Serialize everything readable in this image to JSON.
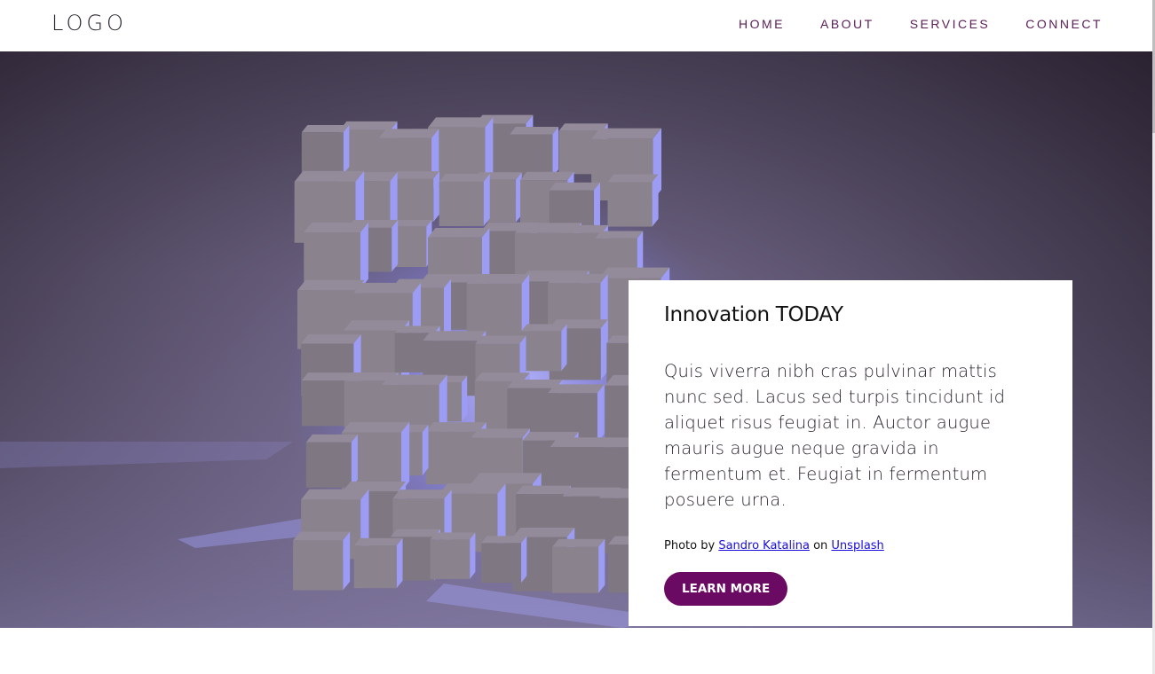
{
  "nav": {
    "logo": "LOGO",
    "links": [
      "HOME",
      "ABOUT",
      "SERVICES",
      "CONNECT"
    ]
  },
  "hero": {
    "image_subject": "glowing purple cube of gray blocks",
    "card": {
      "title": "Innovation TODAY",
      "body": "Quis viverra nibh cras pulvinar mattis nunc sed. Lacus sed turpis tincidunt id aliquet risus feugiat in. Auctor augue mauris augue neque gravida in fermentum et. Feugiat in fermentum posuere urna.",
      "credit_prefix": "Photo by",
      "credit_author": "Sandro Katalina",
      "credit_middle": "on",
      "credit_site": "Unsplash",
      "button_label": "LEARN MORE"
    }
  },
  "colors": {
    "accent": "#6a0a63",
    "nav_text": "#5a1e55",
    "link": "#1a0ddb",
    "glow": "#8c8cff"
  }
}
